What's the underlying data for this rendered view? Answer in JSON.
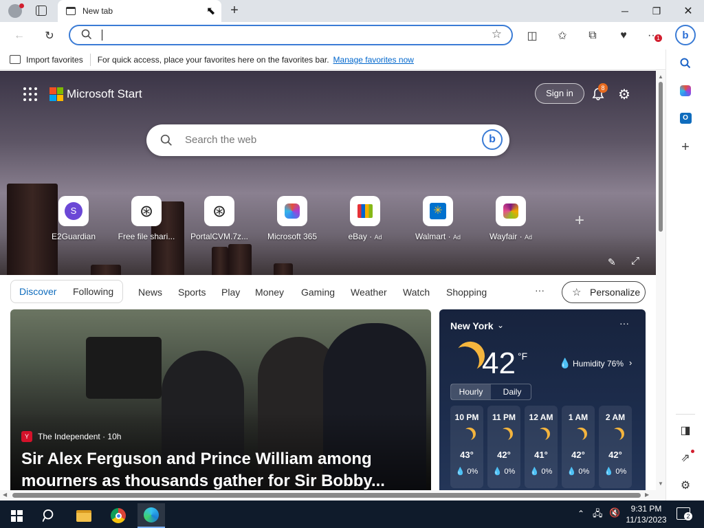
{
  "browser": {
    "tab_title": "New tab",
    "address_value": "",
    "favorites_bar": {
      "import_label": "Import favorites",
      "message": "For quick access, place your favorites here on the favorites bar.",
      "manage_link": "Manage favorites now"
    },
    "sidebar_badge": "1"
  },
  "page": {
    "brand": "Microsoft Start",
    "sign_in": "Sign in",
    "notif_count": "8",
    "search_placeholder": "Search the web",
    "tiles": [
      {
        "label": "E2Guardian",
        "ad": "",
        "icon": "letter-s-icon"
      },
      {
        "label": "Free file shari...",
        "ad": "",
        "icon": "film-reel-icon"
      },
      {
        "label": "PortalCVM.7z...",
        "ad": "",
        "icon": "film-reel-icon"
      },
      {
        "label": "Microsoft 365",
        "ad": "",
        "icon": "m365-icon"
      },
      {
        "label": "eBay",
        "ad": "Ad",
        "icon": "shopping-bag-icon"
      },
      {
        "label": "Walmart",
        "ad": "Ad",
        "icon": "walmart-spark-icon"
      },
      {
        "label": "Wayfair",
        "ad": "Ad",
        "icon": "wayfair-icon"
      }
    ],
    "tabs": {
      "discover": "Discover",
      "following": "Following"
    },
    "categories": [
      "News",
      "Sports",
      "Play",
      "Money",
      "Gaming",
      "Weather",
      "Watch",
      "Shopping"
    ],
    "more": "···",
    "personalize": "Personalize",
    "article": {
      "source": "The Independent · 10h",
      "title_line1": "Sir Alex Ferguson and Prince William among",
      "title_line2": "mourners as thousands gather for Sir Bobby..."
    },
    "weather": {
      "city": "New York",
      "temp": "42",
      "unit": "°F",
      "humidity": "Humidity 76%",
      "tab_hourly": "Hourly",
      "tab_daily": "Daily",
      "hours": [
        {
          "time": "10 PM",
          "temp": "43°",
          "precip": "0%"
        },
        {
          "time": "11 PM",
          "temp": "42°",
          "precip": "0%"
        },
        {
          "time": "12 AM",
          "temp": "41°",
          "precip": "0%"
        },
        {
          "time": "1 AM",
          "temp": "42°",
          "precip": "0%"
        },
        {
          "time": "2 AM",
          "temp": "42°",
          "precip": "0%"
        }
      ]
    }
  },
  "taskbar": {
    "time": "9:31 PM",
    "date": "11/13/2023",
    "notification_count": "2"
  },
  "colors": {
    "accent": "#0f6cbd",
    "link": "#0066cc",
    "badge": "#e66a1f"
  }
}
